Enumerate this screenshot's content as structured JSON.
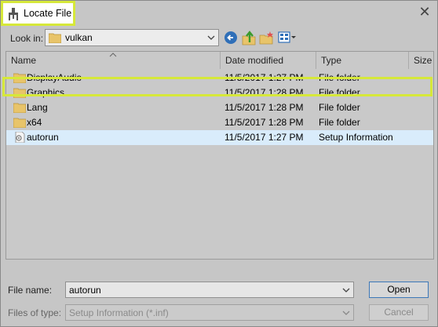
{
  "window": {
    "title": "Locate File",
    "close_symbol": "✕"
  },
  "toolbar": {
    "look_in_label": "Look in:",
    "look_in_value": "vulkan",
    "icons": [
      "back-arrow-icon",
      "up-folder-icon",
      "new-folder-icon",
      "view-menu-icon"
    ]
  },
  "list": {
    "columns": [
      "Name",
      "Date modified",
      "Type",
      "Size"
    ],
    "rows": [
      {
        "name": "DisplayAudio",
        "date": "11/5/2017 1:27 PM",
        "type": "File folder",
        "icon": "folder-icon"
      },
      {
        "name": "Graphics",
        "date": "11/5/2017 1:28 PM",
        "type": "File folder",
        "icon": "folder-icon"
      },
      {
        "name": "Lang",
        "date": "11/5/2017 1:28 PM",
        "type": "File folder",
        "icon": "folder-icon"
      },
      {
        "name": "x64",
        "date": "11/5/2017 1:28 PM",
        "type": "File folder",
        "icon": "folder-icon"
      },
      {
        "name": "autorun",
        "date": "11/5/2017 1:27 PM",
        "type": "Setup Information",
        "icon": "setup-file-icon",
        "selected": true
      }
    ]
  },
  "footer": {
    "file_name_label": "File name:",
    "file_name_value": "autorun",
    "files_of_type_label": "Files of type:",
    "files_of_type_value": "Setup Information (*.inf)",
    "open_label": "Open",
    "cancel_label": "Cancel"
  },
  "colors": {
    "highlight": "#d6e83a",
    "selection": "#d9ecfb",
    "folder": "#e8c46a"
  }
}
